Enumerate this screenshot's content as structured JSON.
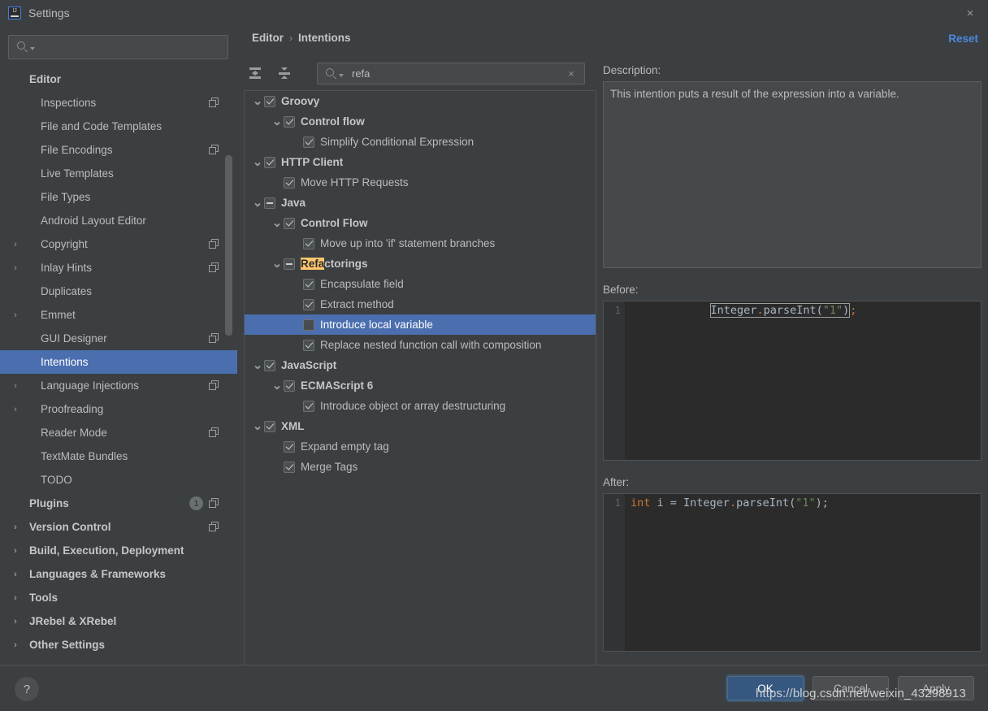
{
  "window": {
    "title": "Settings",
    "logo_text": "IJ",
    "close_icon": "×"
  },
  "sidebar": {
    "search": {
      "value": "",
      "placeholder": ""
    },
    "items": [
      {
        "label": "Editor",
        "level": 0,
        "bold": true,
        "arrow": "",
        "copy": false,
        "selected": false
      },
      {
        "label": "Inspections",
        "level": 1,
        "bold": false,
        "arrow": "",
        "copy": true,
        "selected": false
      },
      {
        "label": "File and Code Templates",
        "level": 1,
        "bold": false,
        "arrow": "",
        "copy": false,
        "selected": false
      },
      {
        "label": "File Encodings",
        "level": 1,
        "bold": false,
        "arrow": "",
        "copy": true,
        "selected": false
      },
      {
        "label": "Live Templates",
        "level": 1,
        "bold": false,
        "arrow": "",
        "copy": false,
        "selected": false
      },
      {
        "label": "File Types",
        "level": 1,
        "bold": false,
        "arrow": "",
        "copy": false,
        "selected": false
      },
      {
        "label": "Android Layout Editor",
        "level": 1,
        "bold": false,
        "arrow": "",
        "copy": false,
        "selected": false
      },
      {
        "label": "Copyright",
        "level": 1,
        "bold": false,
        "arrow": "›",
        "copy": true,
        "selected": false
      },
      {
        "label": "Inlay Hints",
        "level": 1,
        "bold": false,
        "arrow": "›",
        "copy": true,
        "selected": false
      },
      {
        "label": "Duplicates",
        "level": 1,
        "bold": false,
        "arrow": "",
        "copy": false,
        "selected": false
      },
      {
        "label": "Emmet",
        "level": 1,
        "bold": false,
        "arrow": "›",
        "copy": false,
        "selected": false
      },
      {
        "label": "GUI Designer",
        "level": 1,
        "bold": false,
        "arrow": "",
        "copy": true,
        "selected": false
      },
      {
        "label": "Intentions",
        "level": 1,
        "bold": false,
        "arrow": "",
        "copy": false,
        "selected": true
      },
      {
        "label": "Language Injections",
        "level": 1,
        "bold": false,
        "arrow": "›",
        "copy": true,
        "selected": false
      },
      {
        "label": "Proofreading",
        "level": 1,
        "bold": false,
        "arrow": "›",
        "copy": false,
        "selected": false
      },
      {
        "label": "Reader Mode",
        "level": 1,
        "bold": false,
        "arrow": "",
        "copy": true,
        "selected": false
      },
      {
        "label": "TextMate Bundles",
        "level": 1,
        "bold": false,
        "arrow": "",
        "copy": false,
        "selected": false
      },
      {
        "label": "TODO",
        "level": 1,
        "bold": false,
        "arrow": "",
        "copy": false,
        "selected": false
      },
      {
        "label": "Plugins",
        "level": 0,
        "bold": true,
        "arrow": "",
        "copy": true,
        "selected": false,
        "badge": "1"
      },
      {
        "label": "Version Control",
        "level": 0,
        "bold": true,
        "arrow": "›",
        "copy": true,
        "selected": false
      },
      {
        "label": "Build, Execution, Deployment",
        "level": 0,
        "bold": true,
        "arrow": "›",
        "copy": false,
        "selected": false
      },
      {
        "label": "Languages & Frameworks",
        "level": 0,
        "bold": true,
        "arrow": "›",
        "copy": false,
        "selected": false
      },
      {
        "label": "Tools",
        "level": 0,
        "bold": true,
        "arrow": "›",
        "copy": false,
        "selected": false
      },
      {
        "label": "JRebel & XRebel",
        "level": 0,
        "bold": true,
        "arrow": "›",
        "copy": false,
        "selected": false
      },
      {
        "label": "Other Settings",
        "level": 0,
        "bold": true,
        "arrow": "›",
        "copy": false,
        "selected": false
      }
    ]
  },
  "main": {
    "breadcrumb": {
      "parent": "Editor",
      "separator": "›",
      "current": "Intentions"
    },
    "reset_label": "Reset",
    "toolbar": {
      "expand_all_title": "Expand All",
      "collapse_all_title": "Collapse All"
    },
    "filter": {
      "value": "refa",
      "placeholder": "",
      "clear_icon": "×"
    },
    "tree": [
      {
        "label": "Groovy",
        "indent": 0,
        "tri": "⌄",
        "check": "checked",
        "bold": true,
        "selected": false
      },
      {
        "label": "Control flow",
        "indent": 1,
        "tri": "⌄",
        "check": "checked",
        "bold": true,
        "selected": false
      },
      {
        "label": "Simplify Conditional Expression",
        "indent": 2,
        "tri": "",
        "check": "checked",
        "bold": false,
        "selected": false
      },
      {
        "label": "HTTP Client",
        "indent": 0,
        "tri": "⌄",
        "check": "checked",
        "bold": true,
        "selected": false
      },
      {
        "label": "Move HTTP Requests",
        "indent": 1,
        "tri": "",
        "check": "checked",
        "bold": false,
        "selected": false
      },
      {
        "label": "Java",
        "indent": 0,
        "tri": "⌄",
        "check": "partial",
        "bold": true,
        "selected": false
      },
      {
        "label": "Control Flow",
        "indent": 1,
        "tri": "⌄",
        "check": "checked",
        "bold": true,
        "selected": false
      },
      {
        "label": "Move up into 'if' statement branches",
        "indent": 2,
        "tri": "",
        "check": "checked",
        "bold": false,
        "selected": false
      },
      {
        "label": "Refactorings",
        "indent": 1,
        "tri": "⌄",
        "check": "partial",
        "bold": true,
        "selected": false,
        "highlight": "Refa"
      },
      {
        "label": "Encapsulate field",
        "indent": 2,
        "tri": "",
        "check": "checked",
        "bold": false,
        "selected": false
      },
      {
        "label": "Extract method",
        "indent": 2,
        "tri": "",
        "check": "checked",
        "bold": false,
        "selected": false
      },
      {
        "label": "Introduce local variable",
        "indent": 2,
        "tri": "",
        "check": "unchecked",
        "bold": false,
        "selected": true
      },
      {
        "label": "Replace nested function call with composition",
        "indent": 2,
        "tri": "",
        "check": "checked",
        "bold": false,
        "selected": false
      },
      {
        "label": "JavaScript",
        "indent": 0,
        "tri": "⌄",
        "check": "checked",
        "bold": true,
        "selected": false
      },
      {
        "label": "ECMAScript 6",
        "indent": 1,
        "tri": "⌄",
        "check": "checked",
        "bold": true,
        "selected": false
      },
      {
        "label": "Introduce object or array destructuring",
        "indent": 2,
        "tri": "",
        "check": "checked",
        "bold": false,
        "selected": false
      },
      {
        "label": "XML",
        "indent": 0,
        "tri": "⌄",
        "check": "checked",
        "bold": true,
        "selected": false
      },
      {
        "label": "Expand empty tag",
        "indent": 1,
        "tri": "",
        "check": "checked",
        "bold": false,
        "selected": false
      },
      {
        "label": "Merge Tags",
        "indent": 1,
        "tri": "",
        "check": "checked",
        "bold": false,
        "selected": false
      }
    ]
  },
  "detail": {
    "description_label": "Description:",
    "description_text": "This intention puts a result of the expression into a variable.",
    "before_label": "Before:",
    "before_line_number": "1",
    "before_code": {
      "selected_part": "Integer.parseInt(\"1\")",
      "trailing": ";",
      "tokens": [
        {
          "t": "Integer",
          "c": "def"
        },
        {
          "t": ".",
          "c": "dot"
        },
        {
          "t": "parseInt(",
          "c": "def"
        },
        {
          "t": "\"1\"",
          "c": "str"
        },
        {
          "t": ")",
          "c": "def"
        }
      ]
    },
    "after_label": "After:",
    "after_line_number": "1",
    "after_code": {
      "full": "int i = Integer.parseInt(\"1\");",
      "tokens": [
        {
          "t": "int",
          "c": "kw"
        },
        {
          "t": " i = Integer",
          "c": "def"
        },
        {
          "t": ".",
          "c": "dot"
        },
        {
          "t": "parseInt(",
          "c": "def"
        },
        {
          "t": "\"1\"",
          "c": "str"
        },
        {
          "t": ");",
          "c": "def"
        }
      ]
    }
  },
  "footer": {
    "help_label": "?",
    "ok_label": "OK",
    "cancel_label": "Cancel",
    "apply_label": "Apply"
  },
  "watermark": "https://blog.csdn.net/weixin_43298913",
  "colors": {
    "window_bg": "#3c3f41",
    "selection_blue": "#4b6eaf",
    "accent_link": "#4a88e0",
    "primary_button": "#365880",
    "search_highlight": "#ffc66d",
    "code_bg": "#2b2b2b",
    "code_string": "#6a8759",
    "code_keyword": "#cc7832",
    "code_default": "#a9b7c6"
  }
}
